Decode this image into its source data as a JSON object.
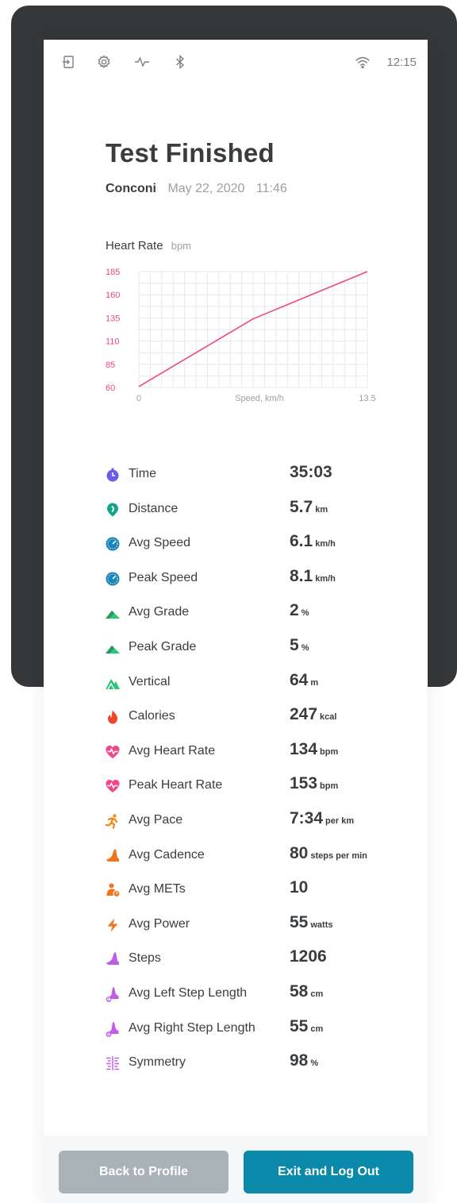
{
  "status_bar": {
    "time": "12:15",
    "left_icons": [
      "exit-icon",
      "gear-icon",
      "activity-icon",
      "bluetooth-icon"
    ],
    "right_icons": [
      "wifi-icon"
    ]
  },
  "header": {
    "title": "Test Finished",
    "test_name": "Conconi",
    "date": "May 22, 2020",
    "time": "11:46"
  },
  "chart_data": {
    "type": "line",
    "title": "Heart Rate",
    "ylabel": "bpm",
    "xlabel": "Speed, km/h",
    "x_ticks": [
      "0",
      "13.5"
    ],
    "y_ticks": [
      "185",
      "160",
      "135",
      "110",
      "85",
      "60"
    ],
    "xlim": [
      0,
      13.5
    ],
    "ylim": [
      60,
      185
    ],
    "grid": true,
    "series": [
      {
        "color": "#f0468c",
        "x": [
          0,
          6.75,
          13.5
        ],
        "y": [
          61,
          134,
          185
        ]
      }
    ],
    "colors": {
      "line": "#f0468c",
      "y_ticks": "#f0468c",
      "x_ticks": "#9aa0a6",
      "grid": "#e6e8ea"
    }
  },
  "stats": [
    {
      "icon": "stopwatch-icon",
      "color": "#6a5ce8",
      "label": "Time",
      "value": "35:03",
      "unit": ""
    },
    {
      "icon": "location-pin-icon",
      "color": "#14a48a",
      "label": "Distance",
      "value": "5.7",
      "unit": "km"
    },
    {
      "icon": "speedometer-icon",
      "color": "#1a84b8",
      "label": "Avg Speed",
      "value": "6.1",
      "unit": "km/h"
    },
    {
      "icon": "speedometer-icon",
      "color": "#1a84b8",
      "label": "Peak Speed",
      "value": "8.1",
      "unit": "km/h"
    },
    {
      "icon": "incline-icon",
      "color": "#2ec47a",
      "label": "Avg Grade",
      "value": "2",
      "unit": "%"
    },
    {
      "icon": "incline-icon",
      "color": "#2ec47a",
      "label": "Peak Grade",
      "value": "5",
      "unit": "%"
    },
    {
      "icon": "mountain-icon",
      "color": "#2ec47a",
      "label": "Vertical",
      "value": "64",
      "unit": "m"
    },
    {
      "icon": "flame-icon",
      "color": "#f0462a",
      "label": "Calories",
      "value": "247",
      "unit": "kcal"
    },
    {
      "icon": "heart-pulse-icon",
      "color": "#f0468c",
      "label": "Avg Heart Rate",
      "value": "134",
      "unit": "bpm"
    },
    {
      "icon": "heart-pulse-icon",
      "color": "#f0468c",
      "label": "Peak Heart Rate",
      "value": "153",
      "unit": "bpm"
    },
    {
      "icon": "runner-icon",
      "color": "#f28c1c",
      "label": "Avg Pace",
      "value": "7:34",
      "unit": "per km"
    },
    {
      "icon": "shoe-icon",
      "color": "#f2741c",
      "label": "Avg Cadence",
      "value": "80",
      "unit": "steps per min"
    },
    {
      "icon": "mets-icon",
      "color": "#f2741c",
      "label": "Avg METs",
      "value": "10",
      "unit": ""
    },
    {
      "icon": "lightning-icon",
      "color": "#f2741c",
      "label": "Avg Power",
      "value": "55",
      "unit": "watts"
    },
    {
      "icon": "shoe-icon",
      "color": "#c05ce8",
      "label": "Steps",
      "value": "1206",
      "unit": ""
    },
    {
      "icon": "shoe-left-icon",
      "color": "#c05ce8",
      "label": "Avg Left Step Length",
      "value": "58",
      "unit": "cm"
    },
    {
      "icon": "shoe-right-icon",
      "color": "#c05ce8",
      "label": "Avg Right Step Length",
      "value": "55",
      "unit": "cm"
    },
    {
      "icon": "symmetry-icon",
      "color": "#c05ce8",
      "label": "Symmetry",
      "value": "98",
      "unit": "%"
    }
  ],
  "footer": {
    "back_label": "Back to Profile",
    "exit_label": "Exit and Log Out",
    "colors": {
      "back": "#a8b2b7",
      "exit": "#0a89ab"
    }
  }
}
